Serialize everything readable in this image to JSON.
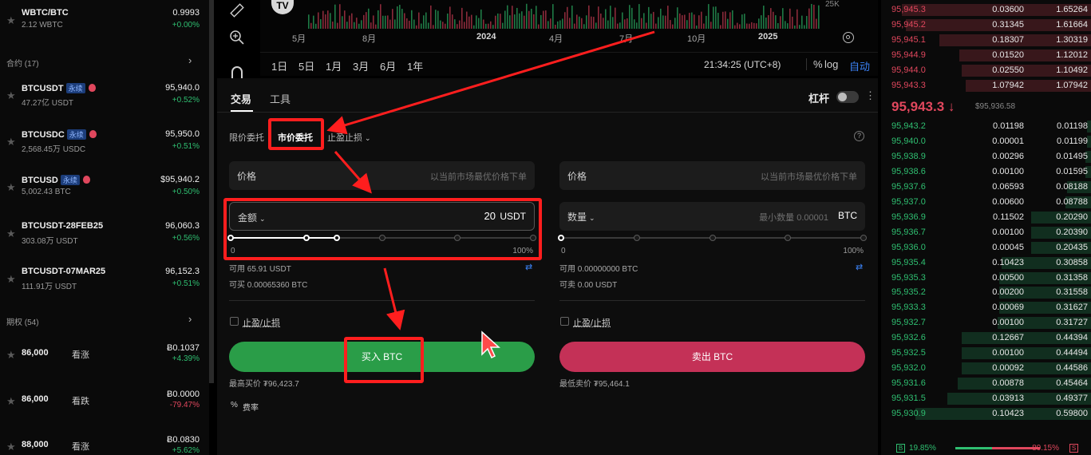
{
  "markets": {
    "top": {
      "name": "WBTC/BTC",
      "sub": "2.12 WBTC",
      "price": "0.9993",
      "change": "+0.00%"
    },
    "contracts_header": "合约 (17)",
    "contracts": [
      {
        "name": "BTCUSDT",
        "tag": "永续",
        "hot": true,
        "sub": "47.27亿 USDT",
        "price": "95,940.0",
        "change": "+0.52%"
      },
      {
        "name": "BTCUSDC",
        "tag": "永续",
        "hot": true,
        "sub": "2,568.45万 USDC",
        "price": "95,950.0",
        "change": "+0.51%"
      },
      {
        "name": "BTCUSD",
        "tag": "永续",
        "hot": true,
        "sub": "5,002.43 BTC",
        "price": "$95,940.2",
        "change": "+0.50%"
      },
      {
        "name": "BTCUSDT-28FEB25",
        "tag": "",
        "hot": false,
        "sub": "303.08万 USDT",
        "price": "96,060.3",
        "change": "+0.56%"
      },
      {
        "name": "BTCUSDT-07MAR25",
        "tag": "",
        "hot": false,
        "sub": "111.91万 USDT",
        "price": "96,152.3",
        "change": "+0.51%"
      }
    ],
    "options_header": "期权 (54)",
    "options": [
      {
        "strike": "86,000",
        "side": "看涨",
        "price": "Ƀ0.1037",
        "change": "+4.39%"
      },
      {
        "strike": "86,000",
        "side": "看跌",
        "price": "Ƀ0.0000",
        "change": "-79.47%"
      },
      {
        "strike": "88,000",
        "side": "看涨",
        "price": "Ƀ0.0830",
        "change": "+5.62%"
      }
    ]
  },
  "chart": {
    "xlabels": [
      "5月",
      "8月",
      "2024",
      "4月",
      "7月",
      "10月",
      "2025"
    ],
    "logo": "TV",
    "volume_label": "25K",
    "timeframes": [
      "1日",
      "5日",
      "1月",
      "3月",
      "6月",
      "1年"
    ],
    "clock": "21:34:25 (UTC+8)",
    "percent": "%",
    "log": "log",
    "auto": "自动"
  },
  "trade": {
    "tabs": [
      "交易",
      "工具"
    ],
    "leverage_label": "杠杆",
    "order_types": [
      "限价委托",
      "市价委托",
      "止盈止损"
    ],
    "buy": {
      "price_label": "价格",
      "price_placeholder": "以当前市场最优价格下单",
      "amount_label": "金额",
      "amount_value": "20",
      "amount_unit": "USDT",
      "slider_min": "0",
      "slider_max": "100%",
      "slider_percent": 35,
      "available": "可用 65.91 USDT",
      "can_buy": "可买 0.00065360 BTC",
      "tpsl": "止盈/止损",
      "button": "买入 BTC",
      "best_price": "最高买价 ₮96,423.7",
      "fee": "费率"
    },
    "sell": {
      "price_label": "价格",
      "price_placeholder": "以当前市场最优价格下单",
      "qty_label": "数量",
      "qty_placeholder": "最小数量 0.00001",
      "qty_unit": "BTC",
      "slider_min": "0",
      "slider_max": "100%",
      "slider_percent": 0,
      "available": "可用 0.00000000 BTC",
      "can_sell": "可卖 0.00 USDT",
      "tpsl": "止盈/止损",
      "button": "卖出 BTC",
      "best_price": "最低卖价 ₮95,464.1"
    }
  },
  "orderbook": {
    "asks": [
      {
        "price": "95,945.3",
        "size": "0.03600",
        "total": "1.65264",
        "depth": 0.95
      },
      {
        "price": "95,945.2",
        "size": "0.31345",
        "total": "1.61664",
        "depth": 0.93
      },
      {
        "price": "95,945.1",
        "size": "0.18307",
        "total": "1.30319",
        "depth": 0.76
      },
      {
        "price": "95,944.9",
        "size": "0.01520",
        "total": "1.12012",
        "depth": 0.66
      },
      {
        "price": "95,944.0",
        "size": "0.02550",
        "total": "1.10492",
        "depth": 0.65
      },
      {
        "price": "95,943.3",
        "size": "1.07942",
        "total": "1.07942",
        "depth": 0.63
      }
    ],
    "mid_price": "95,943.3 ↓",
    "mid_ref": "$95,936.58",
    "bids": [
      {
        "price": "95,943.2",
        "size": "0.01198",
        "total": "0.01198",
        "depth": 0.02
      },
      {
        "price": "95,940.0",
        "size": "0.00001",
        "total": "0.01199",
        "depth": 0.02
      },
      {
        "price": "95,938.9",
        "size": "0.00296",
        "total": "0.01495",
        "depth": 0.03
      },
      {
        "price": "95,938.6",
        "size": "0.00100",
        "total": "0.01595",
        "depth": 0.03
      },
      {
        "price": "95,937.6",
        "size": "0.06593",
        "total": "0.08188",
        "depth": 0.12
      },
      {
        "price": "95,937.0",
        "size": "0.00600",
        "total": "0.08788",
        "depth": 0.13
      },
      {
        "price": "95,936.9",
        "size": "0.11502",
        "total": "0.20290",
        "depth": 0.3
      },
      {
        "price": "95,936.7",
        "size": "0.00100",
        "total": "0.20390",
        "depth": 0.3
      },
      {
        "price": "95,936.0",
        "size": "0.00045",
        "total": "0.20435",
        "depth": 0.3
      },
      {
        "price": "95,935.4",
        "size": "0.10423",
        "total": "0.30858",
        "depth": 0.45
      },
      {
        "price": "95,935.3",
        "size": "0.00500",
        "total": "0.31358",
        "depth": 0.46
      },
      {
        "price": "95,935.2",
        "size": "0.00200",
        "total": "0.31558",
        "depth": 0.46
      },
      {
        "price": "95,933.3",
        "size": "0.00069",
        "total": "0.31627",
        "depth": 0.46
      },
      {
        "price": "95,932.7",
        "size": "0.00100",
        "total": "0.31727",
        "depth": 0.47
      },
      {
        "price": "95,932.6",
        "size": "0.12667",
        "total": "0.44394",
        "depth": 0.65
      },
      {
        "price": "95,932.5",
        "size": "0.00100",
        "total": "0.44494",
        "depth": 0.65
      },
      {
        "price": "95,932.0",
        "size": "0.00092",
        "total": "0.44586",
        "depth": 0.65
      },
      {
        "price": "95,931.6",
        "size": "0.00878",
        "total": "0.45464",
        "depth": 0.67
      },
      {
        "price": "95,931.5",
        "size": "0.03913",
        "total": "0.49377",
        "depth": 0.72
      },
      {
        "price": "95,930.9",
        "size": "0.10423",
        "total": "0.59800",
        "depth": 0.88
      }
    ],
    "ratio": {
      "buy_label": "B",
      "buy_pct": "19.85%",
      "sell_pct": "80.15%",
      "sell_label": "S"
    }
  },
  "colors": {
    "green": "#2fbf71",
    "red": "#e0475d",
    "buy_button": "#2a9d48",
    "sell_button": "#c43157",
    "highlight": "#ff1e1e"
  },
  "icons": [
    "ruler-icon",
    "zoom-in-icon",
    "magnet-icon",
    "settings-icon",
    "star-icon",
    "fire-icon",
    "info-icon",
    "swap-icon",
    "cursor-icon"
  ]
}
